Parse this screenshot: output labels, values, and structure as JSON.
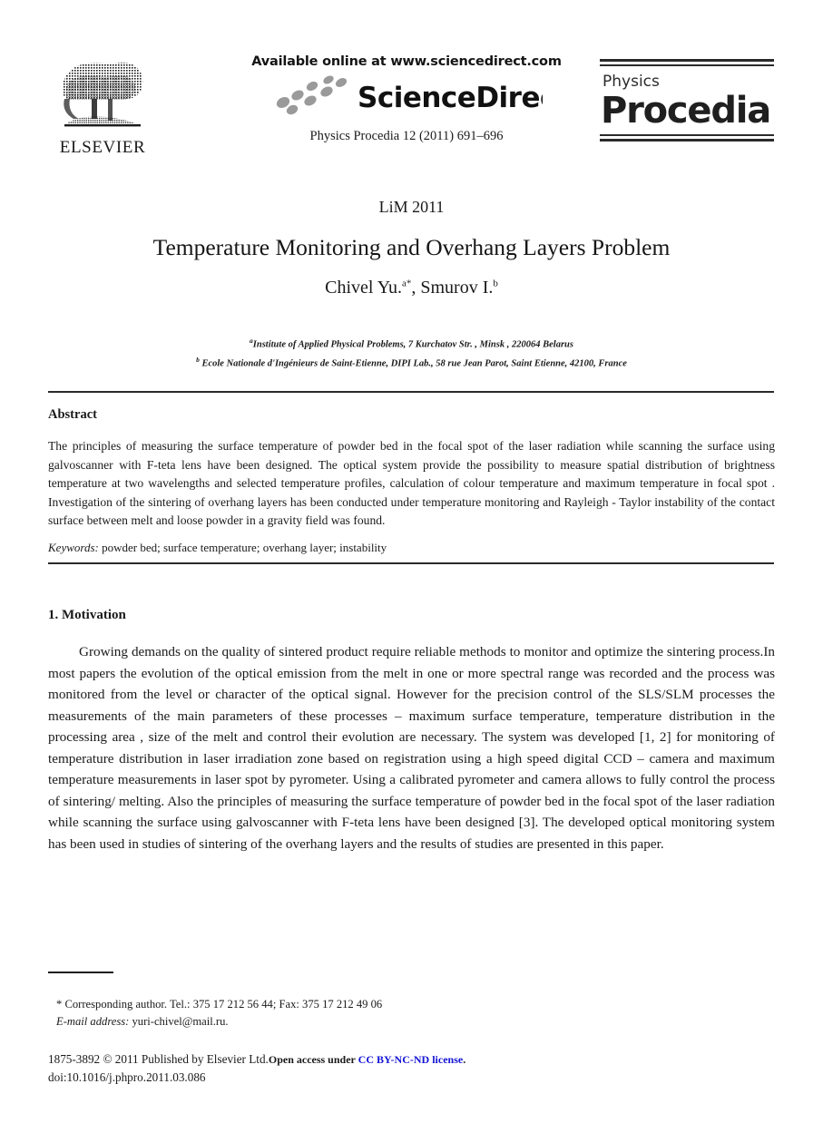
{
  "masthead": {
    "publisher_name": "ELSEVIER",
    "publisher_logo_icon": "elsevier-tree-icon",
    "available_online": "Available online at www.sciencedirect.com",
    "sciencedirect_wordmark": "ScienceDirect",
    "sciencedirect_logo_icon": "sciencedirect-swoosh-icon",
    "citation_line": "Physics Procedia 12 (2011) 691–696",
    "journal_kicker": "Physics",
    "journal_name": "Procedia"
  },
  "article": {
    "conference": "LiM 2011",
    "title": "Temperature Monitoring and Overhang Layers Problem",
    "authors": "Chivel Yu.",
    "author_marker_a": "a",
    "author_marker_star": "*",
    "authors_second": ", Smurov I.",
    "author_marker_b": "b",
    "affiliation_a_marker": "a",
    "affiliation_a": "Institute of Applied Physical Problems, 7 Kurchatov Str. , Minsk , 220064 Belarus",
    "affiliation_b_marker": "b",
    "affiliation_b": " Ecole Nationale d'Ingénieurs de Saint-Etienne, DIPI Lab., 58 rue Jean Parot, Saint Etienne, 42100, France"
  },
  "abstract": {
    "heading": "Abstract",
    "text": "The principles of measuring the surface temperature of powder bed in the focal spot of the laser radiation while scanning the surface using galvoscanner with F-teta lens have been designed. The optical system provide the possibility to measure spatial distribution of brightness temperature at two wavelengths and selected temperature profiles, calculation of colour temperature and maximum temperature in focal spot . Investigation of the sintering of overhang layers has been conducted under temperature monitoring and Rayleigh - Taylor instability of  the contact surface between  melt and loose powder in a gravity field was found.",
    "keywords_label": "Keywords:",
    "keywords_value": " powder bed; surface temperature; overhang layer; instability"
  },
  "section": {
    "heading": "1. Motivation",
    "paragraph": "Growing demands on the quality of sintered product require reliable methods to monitor and optimize the sintering process.In most papers  the evolution of the optical emission from the melt in one or more  spectral range was recorded and the process was monitored from the level or character of the optical signal. However for the precision control of the SLS/SLM processes the measurements of the main parameters of these processes – maximum surface temperature, temperature distribution in the processing area , size of the melt and control their evolution are necessary. The system was developed [1, 2] for monitoring of temperature distribution in laser irradiation zone based on registration using a high speed digital CCD – camera and maximum temperature measurements in laser spot by pyrometer. Using a calibrated pyrometer and camera allows to fully control the process of sintering/ melting. Also the principles of measuring the surface temperature of powder bed in the focal spot of the laser radiation while scanning the surface using  galvoscanner with F-teta lens have been designed [3]. The developed optical monitoring system has been used in studies of sintering of the overhang layers and the results of studies are presented in this paper."
  },
  "footnote": {
    "corresponding": "* Corresponding author. Tel.: 375 17 212 56 44; Fax: 375 17 212 49 06",
    "email_label": "E-mail address:",
    "email_value": " yuri-chivel@mail.ru."
  },
  "copyright": {
    "issn_line": "1875-3892 © 2011 Published by Elsevier Ltd.",
    "open_access": "Open access under ",
    "license": "CC BY-NC-ND license",
    "period": ".",
    "doi": "doi:10.1016/j.phpro.2011.03.086"
  },
  "colors": {
    "text": "#1a1a1a",
    "link": "#1414d6",
    "rule": "#2a2a2a",
    "logo_gray": "#9a9a9a"
  }
}
